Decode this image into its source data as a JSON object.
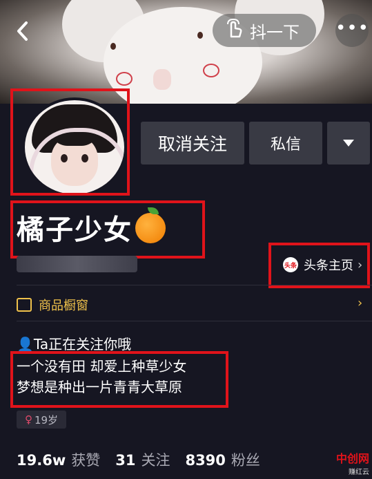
{
  "header": {
    "back_icon": "chevron-left-icon",
    "shake_label": "抖一下",
    "shake_icon": "hand-tap-icon",
    "more_icon": "more-dots-icon"
  },
  "actions": {
    "unfollow_label": "取消关注",
    "message_label": "私信",
    "dropdown_icon": "triangle-down-icon"
  },
  "profile": {
    "nickname": "橘子少女",
    "nickname_emoji": "orange-emoji",
    "toutiao_badge": "头条",
    "toutiao_label": "头条主页",
    "shop_label": "商品橱窗",
    "follows_you": "Ta正在关注你哦",
    "bio_lines": [
      "一个没有田 却爱上种草少女",
      "梦想是种出一片青青大草原"
    ],
    "age": "19岁"
  },
  "stats": [
    {
      "value": "19.6w",
      "label": "获赞"
    },
    {
      "value": "31",
      "label": "关注"
    },
    {
      "value": "8390",
      "label": "粉丝"
    }
  ],
  "watermark": {
    "text": "中创网",
    "sub": "赚红云"
  },
  "colors": {
    "highlight_box": "#e0131a",
    "background": "#161622",
    "shop_accent": "#f0c24b"
  }
}
